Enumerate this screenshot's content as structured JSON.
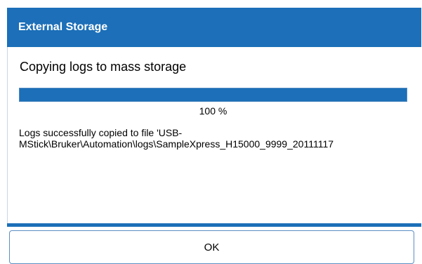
{
  "dialog": {
    "title": "External Storage",
    "heading": "Copying logs to mass storage",
    "progress": {
      "value_percent": 100,
      "label": "100 %"
    },
    "message_line1": "Logs successfully copied to file 'USB-",
    "message_line2": "MStick\\Bruker\\Automation\\logs\\SampleXpress_H15000_9999_20111117",
    "ok_label": "OK"
  },
  "colors": {
    "accent": "#1c6fb8",
    "title_text": "#ffffff",
    "progress_track": "#dde6ef",
    "button_border": "#5b8fc3"
  }
}
